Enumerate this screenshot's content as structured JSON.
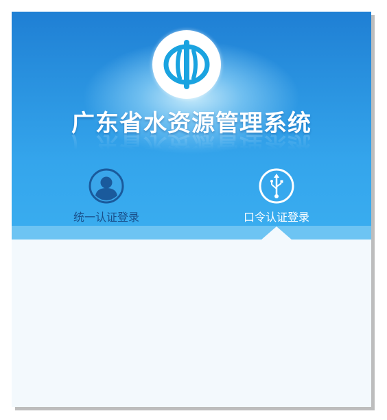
{
  "header": {
    "title": "广东省水资源管理系统",
    "logo": "water-resources-emblem"
  },
  "tabs": [
    {
      "label": "统一认证登录",
      "icon": "user-avatar-icon",
      "active": false
    },
    {
      "label": "口令认证登录",
      "icon": "usb-icon",
      "active": true
    }
  ],
  "colors": {
    "header_top": "#1f7fd4",
    "header_bottom": "#39acef",
    "tab_strip": "#6dc4f3",
    "body_bg": "#f3f9fd",
    "icon_dark": "#1a5a9c",
    "logo_blue": "#1aa3e0"
  }
}
